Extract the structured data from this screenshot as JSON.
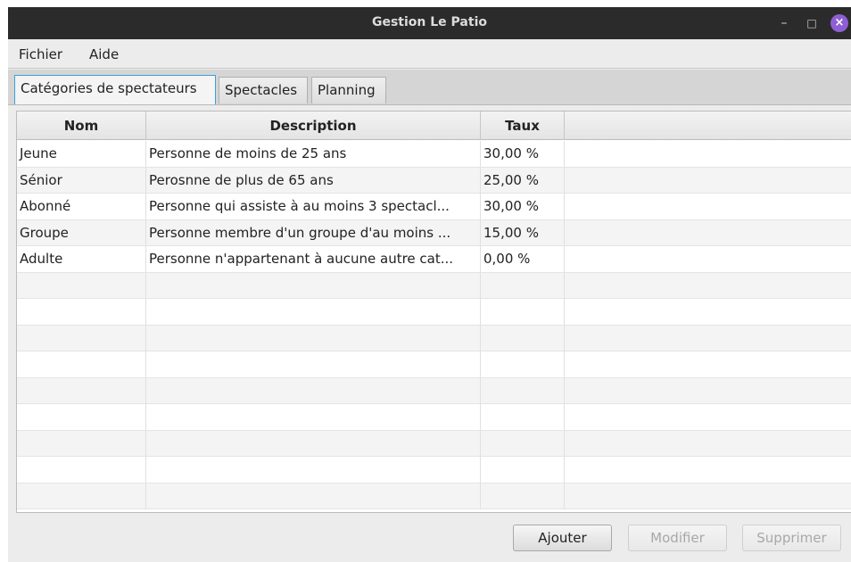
{
  "window": {
    "title": "Gestion Le Patio"
  },
  "window_controls": {
    "minimize": "–",
    "maximize": "□",
    "close": "×"
  },
  "menubar": {
    "items": [
      {
        "label": "Fichier"
      },
      {
        "label": "Aide"
      }
    ]
  },
  "tabs": [
    {
      "label": "Catégories de spectateurs",
      "active": true
    },
    {
      "label": "Spectacles",
      "active": false
    },
    {
      "label": "Planning",
      "active": false
    }
  ],
  "table": {
    "columns": [
      "Nom",
      "Description",
      "Taux",
      ""
    ],
    "rows": [
      {
        "nom": "Jeune",
        "description": "Personne de moins de 25 ans",
        "taux": "30,00 %"
      },
      {
        "nom": "Sénior",
        "description": "Perosnne de plus de 65 ans",
        "taux": "25,00 %"
      },
      {
        "nom": "Abonné",
        "description": "Personne qui assiste à au moins 3 spectacl...",
        "taux": "30,00 %"
      },
      {
        "nom": "Groupe",
        "description": "Personne membre d'un groupe d'au moins ...",
        "taux": "15,00 %"
      },
      {
        "nom": "Adulte",
        "description": "Personne n'appartenant à aucune autre cat...",
        "taux": "0,00 %"
      }
    ]
  },
  "actions": {
    "add": "Ajouter",
    "edit": "Modifier",
    "delete": "Supprimer"
  },
  "colors": {
    "titlebar": "#2b2b2b",
    "close_button": "#8e5fd4",
    "active_tab_border": "#3c9fd8"
  }
}
